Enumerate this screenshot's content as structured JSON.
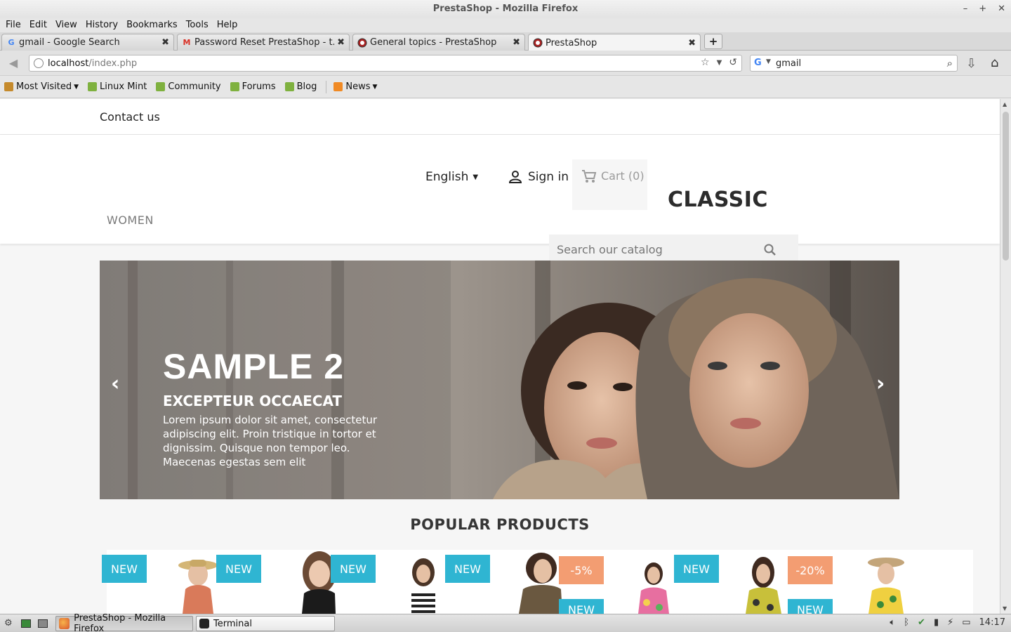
{
  "window": {
    "title": "PrestaShop - Mozilla Firefox"
  },
  "menu": [
    "File",
    "Edit",
    "View",
    "History",
    "Bookmarks",
    "Tools",
    "Help"
  ],
  "tabs": [
    {
      "label": "gmail - Google Search",
      "icon": "google-icon"
    },
    {
      "label": "Password Reset PrestaShop - t...",
      "icon": "gmail-icon"
    },
    {
      "label": "General topics - PrestaShop",
      "icon": "prestashop-icon"
    },
    {
      "label": "PrestaShop",
      "icon": "prestashop-icon",
      "active": true
    }
  ],
  "url": {
    "host": "localhost",
    "path": "/index.php"
  },
  "search": {
    "engine": "G",
    "value": "gmail"
  },
  "bookmarks": [
    {
      "label": "Most Visited",
      "icon": "folder-icon",
      "dropdown": true
    },
    {
      "label": "Linux Mint",
      "icon": "mint-icon"
    },
    {
      "label": "Community",
      "icon": "mint-icon"
    },
    {
      "label": "Forums",
      "icon": "mint-icon"
    },
    {
      "label": "Blog",
      "icon": "mint-icon"
    },
    {
      "label": "News",
      "icon": "rss-icon",
      "dropdown": true
    }
  ],
  "shop": {
    "contact": "Contact us",
    "language": "English",
    "signin": "Sign in",
    "cart": "Cart (0)",
    "logo": "CLASSIC",
    "menu_women": "WOMEN",
    "search_placeholder": "Search our catalog",
    "slide": {
      "title": "SAMPLE 2",
      "subtitle": "EXCEPTEUR OCCAECAT",
      "text": "Lorem ipsum dolor sit amet, consectetur adipiscing elit. Proin tristique in tortor et dignissim. Quisque non tempor leo. Maecenas egestas sem elit"
    },
    "popular_title": "POPULAR PRODUCTS",
    "products": [
      {
        "badge": "NEW"
      },
      {
        "badge": "NEW"
      },
      {
        "badge": "NEW"
      },
      {
        "badge": "NEW",
        "discount": "-5%",
        "badge2": "NEW"
      },
      {
        "badge": "NEW",
        "discount": "-20%",
        "badge2": "NEW"
      }
    ],
    "colors": {
      "badge_new": "#2fb5d2",
      "badge_discount": "#f39d72"
    }
  },
  "taskbar": {
    "items": [
      {
        "label": "PrestaShop - Mozilla Firefox",
        "active": true
      },
      {
        "label": "Terminal",
        "active": false
      }
    ],
    "clock": "14:17"
  }
}
